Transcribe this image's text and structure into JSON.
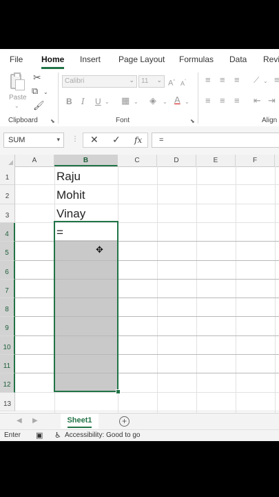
{
  "tabs": {
    "file": "File",
    "home": "Home",
    "insert": "Insert",
    "page_layout": "Page Layout",
    "formulas": "Formulas",
    "data": "Data",
    "review": "Revi"
  },
  "ribbon": {
    "paste_label": "Paste",
    "font_name": "Calibri",
    "font_size": "11",
    "bold": "B",
    "italic": "I",
    "underline": "U",
    "font_color_letter": "A",
    "groups": {
      "clipboard": "Clipboard",
      "font": "Font",
      "alignment": "Align"
    }
  },
  "formula_bar": {
    "name_box": "SUM",
    "cancel": "✕",
    "enter": "✓",
    "fx": "fx",
    "content": "="
  },
  "grid": {
    "columns": [
      "A",
      "B",
      "C",
      "D",
      "E",
      "F"
    ],
    "rows": [
      "1",
      "2",
      "3",
      "4",
      "5",
      "6",
      "7",
      "8",
      "9",
      "10",
      "11",
      "12",
      "13"
    ],
    "cells": {
      "B1": "Raju",
      "B2": "Mohit",
      "B3": "Vinay",
      "B4": "="
    }
  },
  "sheets": {
    "active": "Sheet1",
    "add": "+"
  },
  "status_bar": {
    "mode": "Enter",
    "accessibility": "Accessibility: Good to go"
  },
  "colors": {
    "accent": "#217346",
    "selection_fill": "#c9c9c9"
  }
}
